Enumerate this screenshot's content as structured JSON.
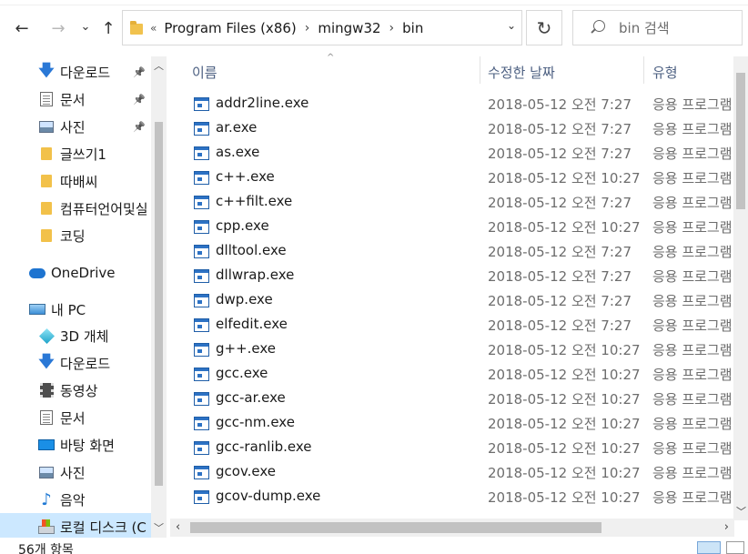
{
  "toolbar": {
    "back_icon": "←",
    "forward_icon": "→",
    "recent_icon": "⌄",
    "up_icon": "↑",
    "refresh_icon": "↻"
  },
  "address": {
    "overflow": "«",
    "crumbs": [
      "Program Files (x86)",
      "mingw32",
      "bin"
    ],
    "separator": "›",
    "dropdown_icon": "⌄"
  },
  "search": {
    "placeholder": "bin 검색"
  },
  "sidebar": {
    "items": [
      {
        "label": "다운로드",
        "icon": "download-icon",
        "pinned": true
      },
      {
        "label": "문서",
        "icon": "document-icon",
        "pinned": true
      },
      {
        "label": "사진",
        "icon": "picture-icon",
        "pinned": true
      },
      {
        "label": "글쓰기1",
        "icon": "folder-icon",
        "pinned": false
      },
      {
        "label": "따배씨",
        "icon": "folder-icon",
        "pinned": false
      },
      {
        "label": "컴퓨터언어및실",
        "icon": "folder-icon",
        "pinned": false
      },
      {
        "label": "코딩",
        "icon": "folder-icon",
        "pinned": false
      },
      {
        "label": "OneDrive",
        "icon": "onedrive-icon",
        "pinned": false
      },
      {
        "label": "내 PC",
        "icon": "pc-icon",
        "pinned": false
      },
      {
        "label": "3D 개체",
        "icon": "3d-objects-icon",
        "pinned": false
      },
      {
        "label": "다운로드",
        "icon": "download-icon",
        "pinned": false
      },
      {
        "label": "동영상",
        "icon": "video-icon",
        "pinned": false
      },
      {
        "label": "문서",
        "icon": "document-icon",
        "pinned": false
      },
      {
        "label": "바탕 화면",
        "icon": "desktop-icon",
        "pinned": false
      },
      {
        "label": "사진",
        "icon": "picture-icon",
        "pinned": false
      },
      {
        "label": "음악",
        "icon": "music-icon",
        "pinned": false
      },
      {
        "label": "로컬 디스크 (C",
        "icon": "local-disk-icon",
        "pinned": false
      }
    ],
    "pin_glyph": "📌"
  },
  "columns": {
    "name": "이름",
    "date": "수정한 날짜",
    "type": "유형",
    "sort_indicator": "^"
  },
  "files": [
    {
      "name": "addr2line.exe",
      "date": "2018-05-12 오전 7:27",
      "type": "응용 프로그램"
    },
    {
      "name": "ar.exe",
      "date": "2018-05-12 오전 7:27",
      "type": "응용 프로그램"
    },
    {
      "name": "as.exe",
      "date": "2018-05-12 오전 7:27",
      "type": "응용 프로그램"
    },
    {
      "name": "c++.exe",
      "date": "2018-05-12 오전 10:27",
      "type": "응용 프로그램"
    },
    {
      "name": "c++filt.exe",
      "date": "2018-05-12 오전 7:27",
      "type": "응용 프로그램"
    },
    {
      "name": "cpp.exe",
      "date": "2018-05-12 오전 10:27",
      "type": "응용 프로그램"
    },
    {
      "name": "dlltool.exe",
      "date": "2018-05-12 오전 7:27",
      "type": "응용 프로그램"
    },
    {
      "name": "dllwrap.exe",
      "date": "2018-05-12 오전 7:27",
      "type": "응용 프로그램"
    },
    {
      "name": "dwp.exe",
      "date": "2018-05-12 오전 7:27",
      "type": "응용 프로그램"
    },
    {
      "name": "elfedit.exe",
      "date": "2018-05-12 오전 7:27",
      "type": "응용 프로그램"
    },
    {
      "name": "g++.exe",
      "date": "2018-05-12 오전 10:27",
      "type": "응용 프로그램"
    },
    {
      "name": "gcc.exe",
      "date": "2018-05-12 오전 10:27",
      "type": "응용 프로그램"
    },
    {
      "name": "gcc-ar.exe",
      "date": "2018-05-12 오전 10:27",
      "type": "응용 프로그램"
    },
    {
      "name": "gcc-nm.exe",
      "date": "2018-05-12 오전 10:27",
      "type": "응용 프로그램"
    },
    {
      "name": "gcc-ranlib.exe",
      "date": "2018-05-12 오전 10:27",
      "type": "응용 프로그램"
    },
    {
      "name": "gcov.exe",
      "date": "2018-05-12 오전 10:27",
      "type": "응용 프로그램"
    },
    {
      "name": "gcov-dump.exe",
      "date": "2018-05-12 오전 10:27",
      "type": "응용 프로그램"
    }
  ],
  "status": {
    "item_count": "56개 항목"
  },
  "colors": {
    "selected_bg": "#cce8ff",
    "header_text": "#4d6082",
    "muted_text": "#6d6d6d",
    "exe_blue": "#2d72c4"
  }
}
